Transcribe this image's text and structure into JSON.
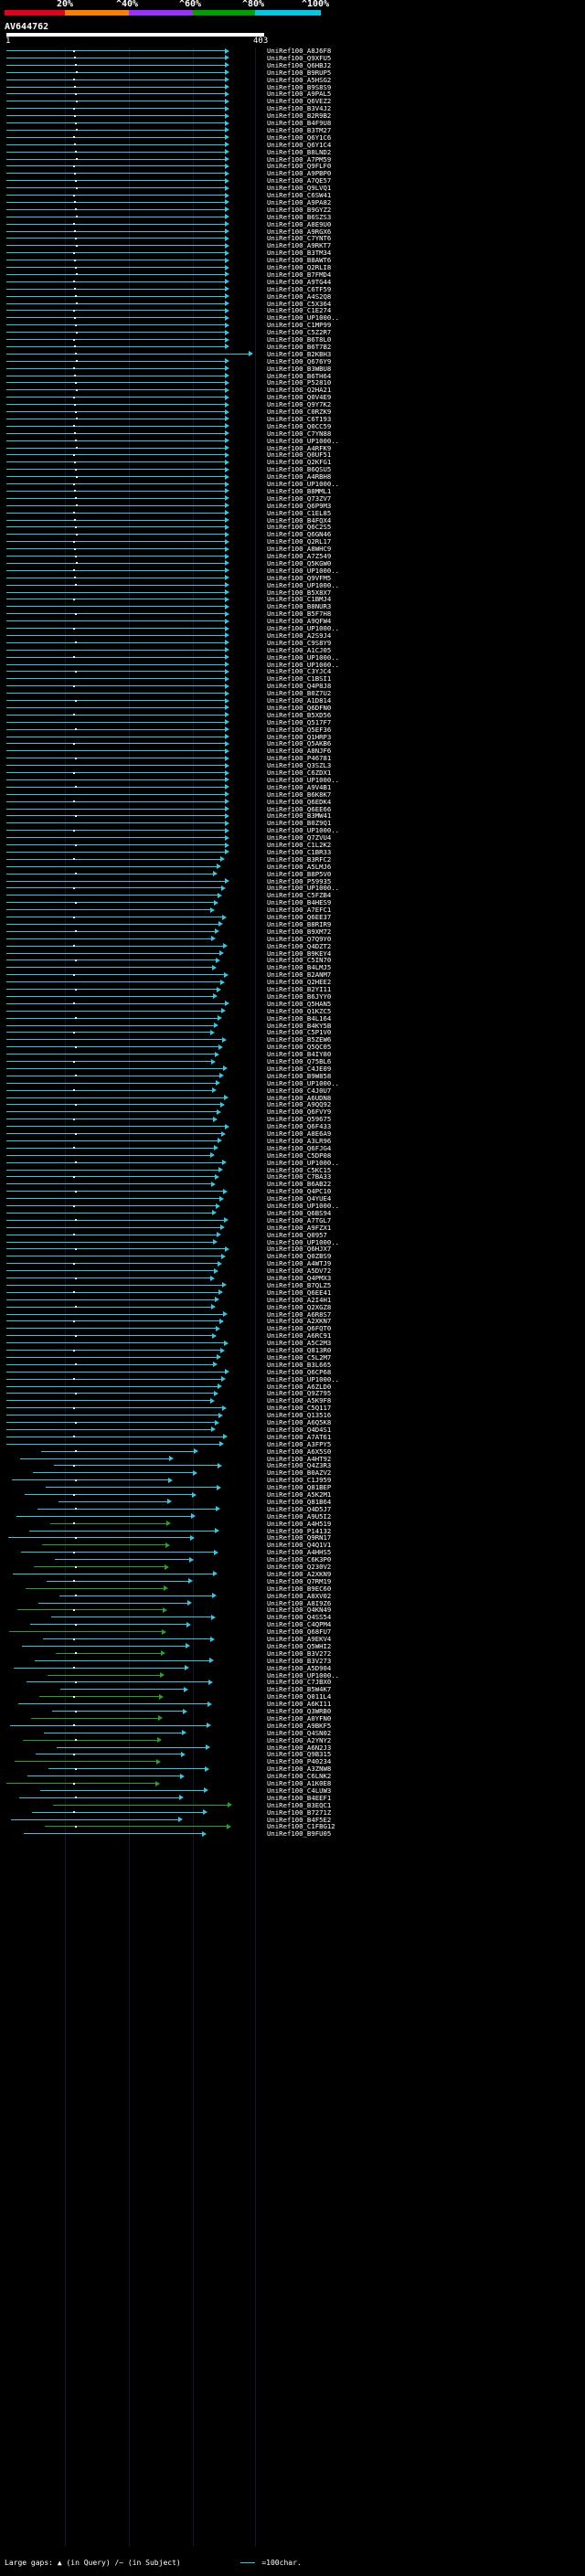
{
  "header": {
    "percent_labels": [
      "20%",
      "^40%",
      "^60%",
      "^80%",
      "^100%"
    ],
    "color_scale": [
      "#e2001a",
      "#ff7f00",
      "#9b30ff",
      "#00a000",
      "#00c8e6"
    ]
  },
  "query": {
    "id": "AV644762",
    "start_label": "1",
    "end_label": "403"
  },
  "hit_colors": {
    "high": "#39c4e0",
    "mid": "#2ca02c",
    "gap_dot": "#ffffff"
  },
  "hits": [
    "UniRef100_A8J6F8",
    "UniRef100_Q9XFU5",
    "UniRef100_Q6HBJ2",
    "UniRef100_B9RUP5",
    "UniRef100_A5HSG2",
    "UniRef100_B9S8S9",
    "UniRef100_A9PAL5",
    "UniRef100_Q6VEZ2",
    "UniRef100_B3V4J2",
    "UniRef100_B2R9B2",
    "UniRef100_B4F9U8",
    "UniRef100_B3TM27",
    "UniRef100_Q6Y1C6",
    "UniRef100_Q6Y1C4",
    "UniRef100_B8LND2",
    "UniRef100_A7PM59",
    "UniRef100_Q9FLF0",
    "UniRef100_A9PBP0",
    "UniRef100_A7QE57",
    "UniRef100_Q9LVQ1",
    "UniRef100_C6SW41",
    "UniRef100_A9PA82",
    "UniRef100_B9GYZ2",
    "UniRef100_B6SZS3",
    "UniRef100_A8E9U0",
    "UniRef100_A9RGX6",
    "UniRef100_C7YNT6",
    "UniRef100_A9RKT7",
    "UniRef100_B3TM34",
    "UniRef100_B8AWT6",
    "UniRef100_Q2RLI8",
    "UniRef100_B7FMD4",
    "UniRef100_A9TG44",
    "UniRef100_C6TF59",
    "UniRef100_A4S2Q8",
    "UniRef100_C5X364",
    "UniRef100_C1E274",
    "UniRef100_UP1000..",
    "UniRef100_C1MP99",
    "UniRef100_C5Z2R7",
    "UniRef100_B6T8L0",
    "UniRef100_B6T7B2",
    "UniRef100_B2KBH3",
    "UniRef100_Q676Y9",
    "UniRef100_B3WBU8",
    "UniRef100_B6TH64",
    "UniRef100_P52810",
    "UniRef100_Q2HA21",
    "UniRef100_Q0V4E9",
    "UniRef100_Q9Y7K2",
    "UniRef100_C0RZK9",
    "UniRef100_C6T193",
    "UniRef100_Q0CC59",
    "UniRef100_C7YN88",
    "UniRef100_UP1000..",
    "UniRef100_A4RFK9",
    "UniRef100_Q0UF51",
    "UniRef100_Q2KFG1",
    "UniRef100_B6QSU5",
    "UniRef100_A4RBH8",
    "UniRef100_UP1000..",
    "UniRef100_B8MML1",
    "UniRef100_Q73ZV7",
    "UniRef100_Q6P9M3",
    "UniRef100_C1EL85",
    "UniRef100_B4FQX4",
    "UniRef100_Q6C2S5",
    "UniRef100_Q6GN46",
    "UniRef100_Q2RL17",
    "UniRef100_A8WHC9",
    "UniRef100_A7Z549",
    "UniRef100_Q5KGW0",
    "UniRef100_UP1000..",
    "UniRef100_Q9VFM5",
    "UniRef100_UP1000..",
    "UniRef100_B5X8X7",
    "UniRef100_C1BMJ4",
    "UniRef100_B8NUR3",
    "UniRef100_B5F7H8",
    "UniRef100_A9QFW4",
    "UniRef100_UP1000..",
    "UniRef100_A2S9J4",
    "UniRef100_C9S8Y9",
    "UniRef100_A1CJ05",
    "UniRef100_UP1000..",
    "UniRef100_UP1000..",
    "UniRef100_C3YJC4",
    "UniRef100_C1BSI1",
    "UniRef100_Q4P8J8",
    "UniRef100_B0Z7U2",
    "UniRef100_A1D814",
    "UniRef100_Q6DFN0",
    "UniRef100_B5XD56",
    "UniRef100_Q517F7",
    "UniRef100_Q5EF36",
    "UniRef100_Q1HRP3",
    "UniRef100_Q5AKB6",
    "UniRef100_A8NJF6",
    "UniRef100_P46781",
    "UniRef100_Q3SZL3",
    "UniRef100_C6ZDX1",
    "UniRef100_UP1000..",
    "UniRef100_A9V4B1",
    "UniRef100_B6K8K7",
    "UniRef100_Q6EDK4",
    "UniRef100_Q6EE66",
    "UniRef100_B3MW41",
    "UniRef100_B0Z9Q1",
    "UniRef100_UP1000..",
    "UniRef100_Q7ZVU4",
    "UniRef100_C1L2K2",
    "UniRef100_C1BR33",
    "UniRef100_B3RFC2",
    "UniRef100_A5LMJ6",
    "UniRef100_B8P5V0",
    "UniRef100_P59935",
    "UniRef100_UP1000..",
    "UniRef100_C5FZB4",
    "UniRef100_B4HES9",
    "UniRef100_A7EFC1",
    "UniRef100_Q6EE37",
    "UniRef100_B8RIR9",
    "UniRef100_B9XM72",
    "UniRef100_Q7Q9Y0",
    "UniRef100_Q4DZT2",
    "UniRef100_B9KEY4",
    "UniRef100_C5IN70",
    "UniRef100_B4LMJ5",
    "UniRef100_B2ANM7",
    "UniRef100_Q2HEE2",
    "UniRef100_B2YI11",
    "UniRef100_B6JYY0",
    "UniRef100_Q5HAN5",
    "UniRef100_Q1KZC5",
    "UniRef100_B4L164",
    "UniRef100_B4KY5B",
    "UniRef100_C5P1V0",
    "UniRef100_B5ZEW6",
    "UniRef100_Q5QC05",
    "UniRef100_B4IY80",
    "UniRef100_Q75BL6",
    "UniRef100_C4JE09",
    "UniRef100_B9W858",
    "UniRef100_UP1000..",
    "UniRef100_C4J0U7",
    "UniRef100_A6UDN8",
    "UniRef100_A9QQ92",
    "UniRef100_Q6FVY9",
    "UniRef100_Q59675",
    "UniRef100_Q6F433",
    "UniRef100_A8E6A9",
    "UniRef100_A3LR96",
    "UniRef100_Q6FJG4",
    "UniRef100_C5DP08",
    "UniRef100_UP1000..",
    "UniRef100_C5KC15",
    "UniRef100_C7BA33",
    "UniRef100_B6AB22",
    "UniRef100_Q4PC10",
    "UniRef100_Q4YUE4",
    "UniRef100_UP1000..",
    "UniRef100_Q6BS94",
    "UniRef100_A7TGL7",
    "UniRef100_A9FZX1",
    "UniRef100_Q0957",
    "UniRef100_UP1000..",
    "UniRef100_Q6HJX7",
    "UniRef100_Q0ZBS9",
    "UniRef100_A4WTJ9",
    "UniRef100_A5DV72",
    "UniRef100_Q4PMX3",
    "UniRef100_B7QLZ5",
    "UniRef100_Q6EE41",
    "UniRef100_A2I4H1",
    "UniRef100_Q2XGZ8",
    "UniRef100_A6R8S7",
    "UniRef100_A2XKN7",
    "UniRef100_Q6FQT0",
    "UniRef100_A6RC91",
    "UniRef100_A5C2M3",
    "UniRef100_Q813R0",
    "UniRef100_C5L2M7",
    "UniRef100_B3L665",
    "UniRef100_Q6CP68",
    "UniRef100_UP1000..",
    "UniRef100_A6ZLD0",
    "UniRef100_Q9Z795",
    "UniRef100_A5K9F8",
    "UniRef100_C5Q117",
    "UniRef100_Q13516",
    "UniRef100_A6Q5K8",
    "UniRef100_Q4D4S1",
    "UniRef100_A7AT61",
    "UniRef100_A3FPY5",
    "UniRef100_A6X5S0",
    "UniRef100_A4HT92",
    "UniRef100_Q4Z3R3",
    "UniRef100_B0AZV2",
    "UniRef100_C1J959",
    "UniRef100_Q81BEP",
    "UniRef100_A5K2M1",
    "UniRef100_Q81B64",
    "UniRef100_Q4D5J7",
    "UniRef100_A9U5I2",
    "UniRef100_A4H519",
    "UniRef100_P14132",
    "UniRef100_Q9RN17",
    "UniRef100_Q4Q1V1",
    "UniRef100_A4HHS5",
    "UniRef100_C6K3P0",
    "UniRef100_Q230V2",
    "UniRef100_A2XKN9",
    "UniRef100_Q7RM19",
    "UniRef100_B9EC60",
    "UniRef100_A8XV02",
    "UniRef100_A8I9Z6",
    "UniRef100_Q4KN49",
    "UniRef100_Q4SS54",
    "UniRef100_C4QPM4",
    "UniRef100_Q68FU7",
    "UniRef100_A9EKV4",
    "UniRef100_Q5WHI2",
    "UniRef100_B3V272",
    "UniRef100_B3V273",
    "UniRef100_A5D904",
    "UniRef100_UP1000..",
    "UniRef100_C7JBX0",
    "UniRef100_B5W4K7",
    "UniRef100_Q011L4",
    "UniRef100_A6KI11",
    "UniRef100_Q3WRB0",
    "UniRef100_A0YFN0",
    "UniRef100_A9BKF5",
    "UniRef100_Q4SN02",
    "UniRef100_A2YNY2",
    "UniRef100_A6N2J3",
    "UniRef100_Q9B315",
    "UniRef100_P40234",
    "UniRef100_A3ZNW8",
    "UniRef100_C6LNK2",
    "UniRef100_A1K0E8",
    "UniRef100_C4LUW3",
    "UniRef100_B4EEF1",
    "UniRef100_B3EQC1",
    "UniRef100_B7271Z",
    "UniRef100_B4F5E2",
    "UniRef100_C1FBG12",
    "UniRef100_B9FU05"
  ],
  "footer": {
    "gaps_label": "Large gaps:",
    "in_query": "(in Query)",
    "in_subject": "(in Subject)",
    "scale_label": "=100char."
  }
}
